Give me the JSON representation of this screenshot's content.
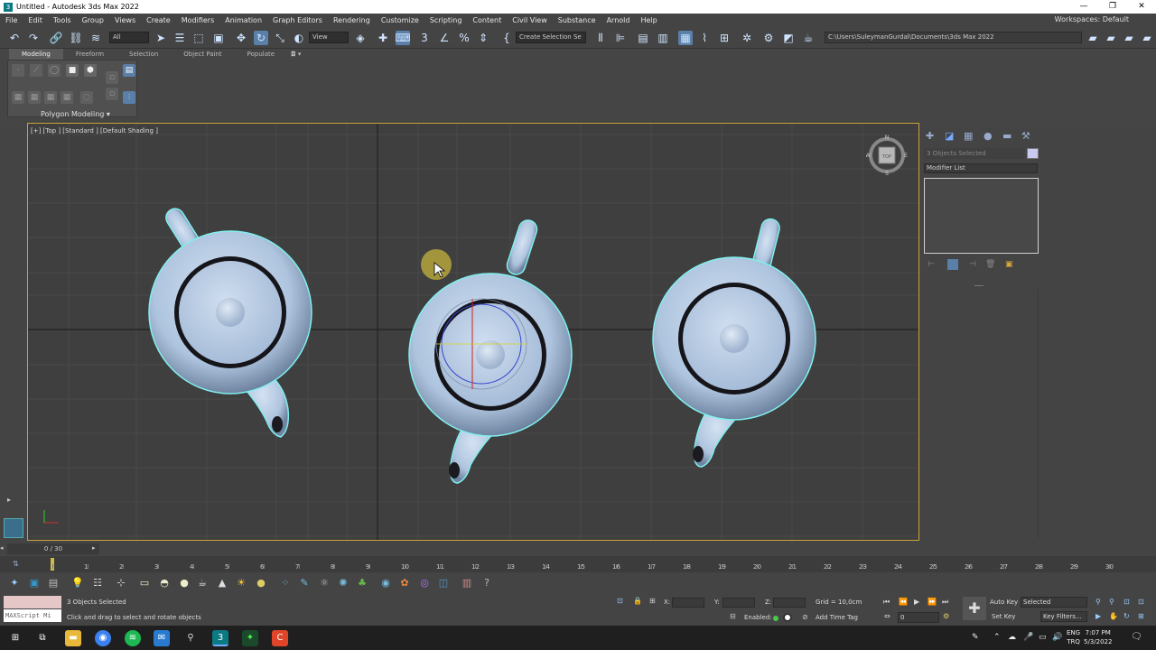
{
  "window": {
    "title": "Untitled - Autodesk 3ds Max 2022",
    "app_icon": "3",
    "minimize": "—",
    "maximize": "❐",
    "close": "✕"
  },
  "menu": [
    "File",
    "Edit",
    "Tools",
    "Group",
    "Views",
    "Create",
    "Modifiers",
    "Animation",
    "Graph Editors",
    "Rendering",
    "Customize",
    "Scripting",
    "Content",
    "Civil View",
    "Substance",
    "Arnold",
    "Help"
  ],
  "workspaces": "Workspaces: Default",
  "toolbar": {
    "filter": "All",
    "refcoord": "View",
    "selection_set": "Create Selection Se",
    "path": "C:\\Users\\SuleymanGurdal\\Documents\\3ds Max 2022"
  },
  "ribbon": {
    "tabs": [
      "Modeling",
      "Freeform",
      "Selection",
      "Object Paint",
      "Populate"
    ],
    "active_tab": "Modeling",
    "panel_label": "Polygon Modeling ▾"
  },
  "viewport": {
    "label": "[+] [Top ] [Standard ] [Default Shading ]",
    "viewcube": {
      "n": "N",
      "s": "S",
      "e": "E",
      "w": "W",
      "face": "TOP"
    }
  },
  "command_panel": {
    "object_name": "3 Objects Selected",
    "modifier_list": "Modifier List"
  },
  "timeline": {
    "slider": "0 / 30",
    "ticks": [
      "0",
      "1",
      "2",
      "3",
      "4",
      "5",
      "6",
      "7",
      "8",
      "9",
      "10",
      "11",
      "12",
      "13",
      "14",
      "15",
      "16",
      "17",
      "18",
      "19",
      "20",
      "21",
      "22",
      "23",
      "24",
      "25",
      "26",
      "27",
      "28",
      "29",
      "30"
    ]
  },
  "status": {
    "maxscript": "MAXScript Mi",
    "selected": "3 Objects Selected",
    "prompt": "Click and drag to select and rotate objects",
    "x_label": "X:",
    "y_label": "Y:",
    "z_label": "Z:",
    "grid": "Grid = 10,0cm",
    "enabled": "Enabled:",
    "add_time_tag": "Add Time Tag",
    "auto_key": "Auto Key",
    "set_key": "Set Key",
    "key_mode": "Selected",
    "key_filters": "Key Filters...",
    "frame": "0"
  },
  "taskbar": {
    "lang_line1": "ENG",
    "lang_line2": "TRQ",
    "time": "7:07 PM",
    "date": "5/3/2022"
  },
  "colors": {
    "selection_outline": "#7ff0ee",
    "viewport_border": "#c9a23b",
    "teapot": "#b9cde6"
  }
}
